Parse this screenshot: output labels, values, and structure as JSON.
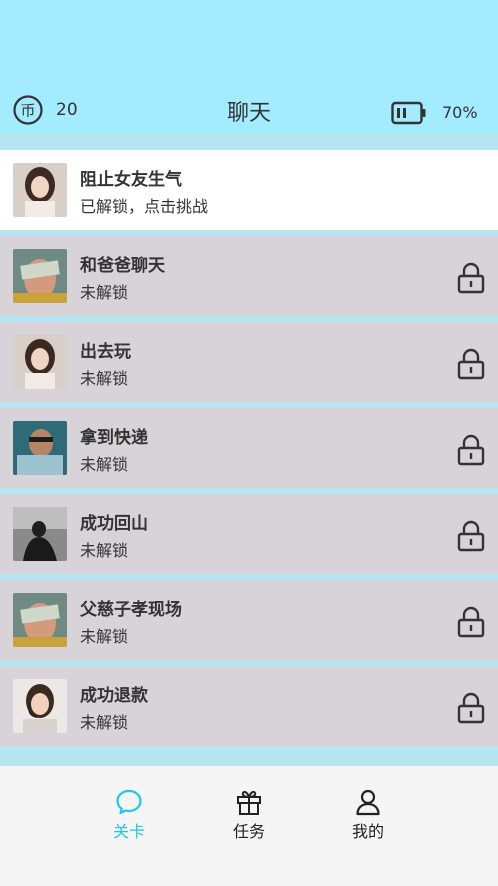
{
  "header": {
    "title": "聊天",
    "coins": "20",
    "battery_percent": "70%",
    "coin_icon_text": "币",
    "coin_icon": "coin-icon",
    "battery_icon": "battery-icon"
  },
  "levels": [
    {
      "title": "阻止女友生气",
      "status": "已解锁，点击挑战",
      "locked": false,
      "avatar": "woman-portrait"
    },
    {
      "title": "和爸爸聊天",
      "status": "未解锁",
      "locked": true,
      "avatar": "man-face-money"
    },
    {
      "title": "出去玩",
      "status": "未解锁",
      "locked": true,
      "avatar": "woman-portrait"
    },
    {
      "title": "拿到快递",
      "status": "未解锁",
      "locked": true,
      "avatar": "courier-man"
    },
    {
      "title": "成功回山",
      "status": "未解锁",
      "locked": true,
      "avatar": "silhouette-mountain"
    },
    {
      "title": "父慈子孝现场",
      "status": "未解锁",
      "locked": true,
      "avatar": "man-face-money"
    },
    {
      "title": "成功退款",
      "status": "未解锁",
      "locked": true,
      "avatar": "support-agent"
    }
  ],
  "tabs": [
    {
      "label": "关卡",
      "icon": "chat-bubble-icon",
      "active": true
    },
    {
      "label": "任务",
      "icon": "gift-icon",
      "active": false
    },
    {
      "label": "我的",
      "icon": "user-icon",
      "active": false
    }
  ],
  "colors": {
    "header_bg": "#a3ebff",
    "page_bg": "#b7e4f1",
    "row_locked_bg": "#d7d3d8",
    "row_unlocked_bg": "#ffffff",
    "tab_active": "#1cc8f0"
  }
}
